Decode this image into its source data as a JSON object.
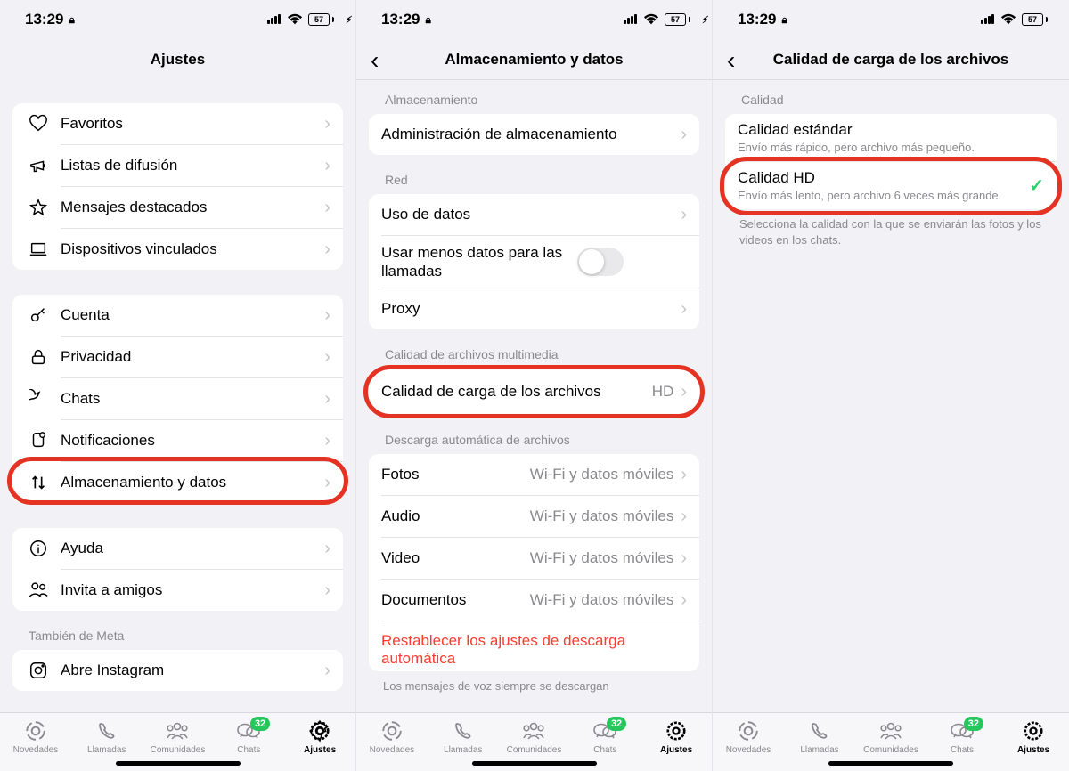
{
  "statusbar": {
    "time": "13:29",
    "battery": "57"
  },
  "tabs": {
    "novedades": "Novedades",
    "llamadas": "Llamadas",
    "comunidades": "Comunidades",
    "chats": "Chats",
    "ajustes": "Ajustes",
    "badge": "32"
  },
  "screen1": {
    "title": "Ajustes",
    "group1": {
      "favoritos": "Favoritos",
      "listas": "Listas de difusión",
      "destacados": "Mensajes destacados",
      "dispositivos": "Dispositivos vinculados"
    },
    "group2": {
      "cuenta": "Cuenta",
      "privacidad": "Privacidad",
      "chats": "Chats",
      "notificaciones": "Notificaciones",
      "almacenamiento": "Almacenamiento y datos"
    },
    "group3": {
      "ayuda": "Ayuda",
      "invita": "Invita a amigos"
    },
    "meta_header": "También de Meta",
    "instagram": "Abre Instagram"
  },
  "screen2": {
    "title": "Almacenamiento y datos",
    "sec_alm": "Almacenamiento",
    "admin": "Administración de almacenamiento",
    "sec_red": "Red",
    "uso": "Uso de datos",
    "usar_menos": "Usar menos datos para las llamadas",
    "proxy": "Proxy",
    "sec_calidad": "Calidad de archivos multimedia",
    "calidad_carga": "Calidad de carga de los archivos",
    "calidad_value": "HD",
    "sec_descarga": "Descarga automática de archivos",
    "fotos": "Fotos",
    "audio": "Audio",
    "video": "Video",
    "documentos": "Documentos",
    "wifi_movil": "Wi-Fi y datos móviles",
    "reset": "Restablecer los ajustes de descarga automática",
    "voicemsg_note": "Los mensajes de voz siempre se descargan"
  },
  "screen3": {
    "title": "Calidad de carga de los archivos",
    "sec": "Calidad",
    "std_title": "Calidad estándar",
    "std_sub": "Envío más rápido, pero archivo más pequeño.",
    "hd_title": "Calidad HD",
    "hd_sub": "Envío más lento, pero archivo 6 veces más grande.",
    "note": "Selecciona la calidad con la que se enviarán las fotos y los videos en los chats."
  }
}
